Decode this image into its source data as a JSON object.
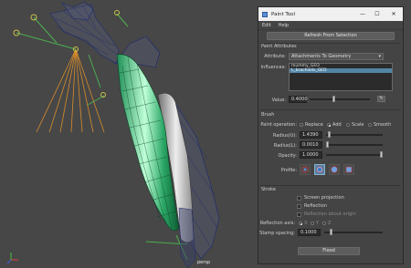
{
  "viewport": {
    "camera_label": "persp",
    "axis_labels": {
      "x": "x",
      "y": "y"
    }
  },
  "window": {
    "title": "Paint Tool",
    "minimize_glyph": "—",
    "maximize_glyph": "☐",
    "close_glyph": "✕",
    "menu": [
      "Edit",
      "Help"
    ]
  },
  "refresh_button": "Refresh From Selection",
  "paint_attributes": {
    "header": "Paint Attributes",
    "attribute_label": "Attribute:",
    "attribute_value": "Attachments To Geometry",
    "influences_label": "Influences:",
    "influences": [
      "mummy_GEO",
      "L_brachialis_GEO"
    ],
    "selected_influence_index": 1,
    "value_label": "Value:",
    "value": "0.4000",
    "value_slider_fraction": 0.4
  },
  "brush": {
    "header": "Brush",
    "paint_operation_label": "Paint operation:",
    "operations": [
      "Replace",
      "Add",
      "Scale",
      "Smooth"
    ],
    "selected_operation": "Add",
    "radius_u_label": "Radius(U):",
    "radius_u": "1.4390",
    "radius_u_slider_fraction": 0.03,
    "radius_l_label": "Radius(L):",
    "radius_l": "0.0010",
    "radius_l_slider_fraction": 0.0,
    "opacity_label": "Opacity:",
    "opacity": "1.0000",
    "opacity_slider_fraction": 1.0,
    "profile_label": "Profile:",
    "profiles": [
      "soft-brush-icon",
      "gaussian-brush-icon",
      "solid-brush-icon",
      "square-brush-icon"
    ],
    "selected_profile_index": 1
  },
  "stroke": {
    "header": "Stroke",
    "screen_projection": "Screen projection",
    "reflection": "Reflection",
    "reflection_about_origin": "Reflection about origin",
    "reflection_axis_label": "Reflection axis:",
    "axes": [
      "X",
      "Y",
      "Z"
    ],
    "selected_axis": "X",
    "stamp_spacing_label": "Stamp spacing:",
    "stamp_spacing": "0.1000",
    "stamp_spacing_slider_fraction": 0.1
  },
  "flood_button": "Flood",
  "colors": {
    "panel_bg": "#444444",
    "viewport_bg": "#474747",
    "selection_blue": "#5285a6",
    "mesh_green": "#7dffb0",
    "wire_navy": "#1c2a6e"
  }
}
